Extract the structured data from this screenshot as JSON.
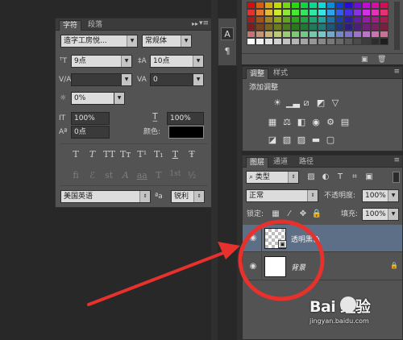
{
  "character_panel": {
    "tabs": [
      "字符",
      "段落"
    ],
    "font_family": "造字工房悦...",
    "font_style": "常规体",
    "font_size": "9点",
    "leading": "10点",
    "kerning": "",
    "tracking": "0",
    "tsume": "0%",
    "vertical_scale": "100%",
    "horizontal_scale": "100%",
    "baseline_shift": "0点",
    "color_label": "颜色:",
    "color_value": "#000000",
    "type_styles": [
      "T",
      "T",
      "TT",
      "Tт",
      "T¹",
      "T₁",
      "T",
      "Ŧ"
    ],
    "opentype": [
      "fi",
      "ℰ",
      "st",
      "A",
      "aa",
      "T",
      "1st",
      "½"
    ],
    "language": "美国英语",
    "aa_label": "ªa",
    "antialias": "锐利"
  },
  "adjustments_panel": {
    "tabs": [
      "调整",
      "样式"
    ],
    "title": "添加调整"
  },
  "layers_panel": {
    "tabs": [
      "图层",
      "通道",
      "路径"
    ],
    "filter_kind": "类型",
    "blend_mode": "正常",
    "opacity_label": "不透明度:",
    "opacity": "100%",
    "lock_label": "锁定:",
    "fill_label": "填充:",
    "fill": "100%",
    "layers": [
      {
        "name": "透明黑色",
        "thumb": "transparent",
        "smart_object": true,
        "selected": true,
        "locked": false
      },
      {
        "name": "背景",
        "thumb": "white",
        "smart_object": false,
        "selected": false,
        "locked": true
      }
    ]
  },
  "colors": {
    "annotation": "#e8312c",
    "panel_bg": "#535353",
    "selected_layer": "#5c6f86"
  },
  "watermark": {
    "logo": "Bai  经验",
    "url": "jingyan.baidu.com"
  }
}
